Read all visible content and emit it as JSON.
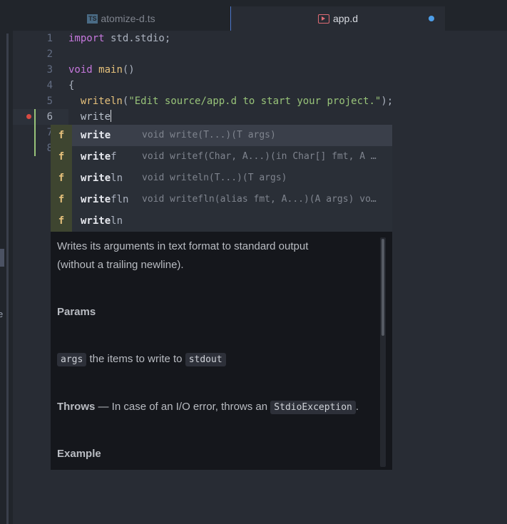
{
  "tabs": [
    {
      "label": "atomize-d.ts",
      "icon": "typescript-file-icon",
      "icon_text": "TS"
    },
    {
      "label": "app.d",
      "icon": "d-file-icon",
      "modified": true
    }
  ],
  "left_edge_char": "e",
  "editor": {
    "line_numbers": [
      "1",
      "2",
      "3",
      "4",
      "5",
      "6",
      "7",
      "8"
    ],
    "current_line": "6",
    "lines": {
      "l1_kw": "import",
      "l1_rest": " std.stdio;",
      "l3_kw": "void",
      "l3_fn": "main",
      "l3_rest": "()",
      "l4": "{",
      "l5_indent": "  ",
      "l5_fn": "writeln",
      "l5_open": "(",
      "l5_str": "\"Edit source/app.d to start your project.\"",
      "l5_close": ");",
      "l6_indent": "  ",
      "l6_text": "write"
    }
  },
  "autocomplete": {
    "items": [
      {
        "kind": "f",
        "match": "write",
        "rest": "",
        "signature": "void write(T...)(T args)"
      },
      {
        "kind": "f",
        "match": "write",
        "rest": "f",
        "signature": "void writef(Char, A...)(in Char[] fmt, A …"
      },
      {
        "kind": "f",
        "match": "write",
        "rest": "ln",
        "signature": "void writeln(T...)(T args)"
      },
      {
        "kind": "f",
        "match": "write",
        "rest": "fln",
        "signature": "void writefln(alias fmt, A...)(A args) vo…"
      },
      {
        "kind": "f",
        "match": "write",
        "rest": "ln",
        "signature": ""
      }
    ]
  },
  "docs": {
    "description_1": "Writes its arguments in text format to standard output",
    "description_2": "(without a trailing newline).",
    "params_heading": "Params",
    "param_name": "args",
    "param_desc": " the items to write to ",
    "param_target": "stdout",
    "throws_heading": "Throws",
    "throws_text": " — In case of an I/O error, throws an ",
    "throws_exception": "StdioException",
    "throws_end": ".",
    "example_heading": "Example"
  },
  "colors": {
    "accent": "#4d9ee8",
    "breakpoint": "#d74a42",
    "git_added": "#98c379"
  }
}
